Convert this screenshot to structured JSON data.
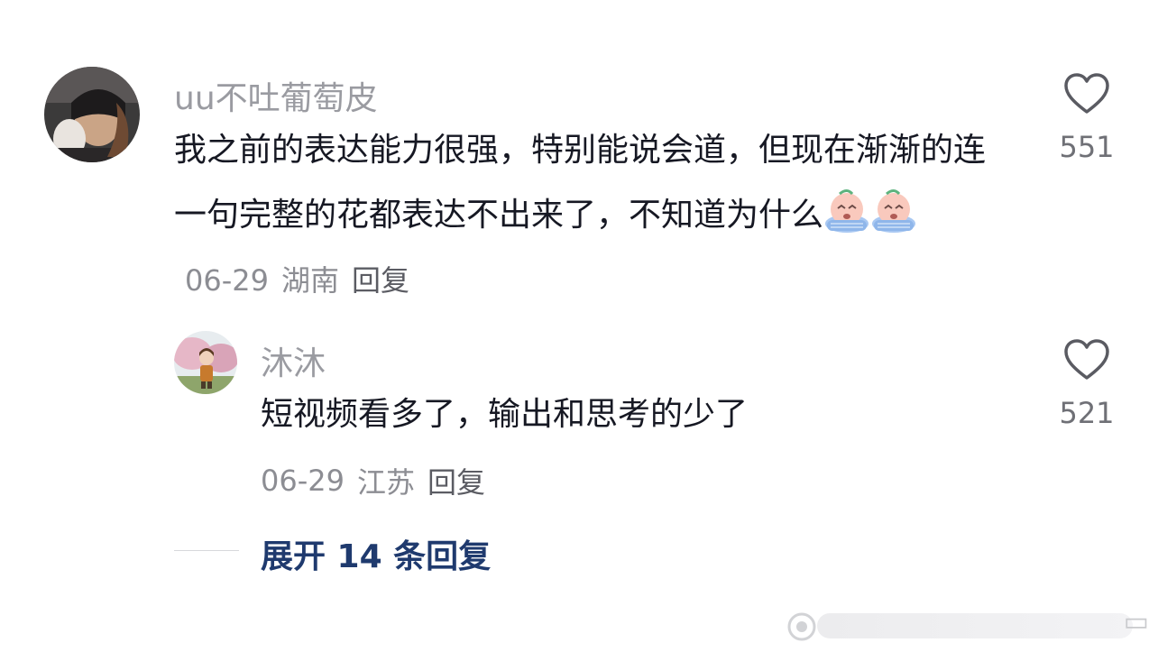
{
  "comments": [
    {
      "username": "uu不吐葡萄皮",
      "text_main": "我之前的表达能力很强，特别能说会道，但现在渐渐的连一句完整的花都表达不出来了，不知道为什么",
      "emojis": [
        "crying-face-emoji",
        "crying-face-emoji"
      ],
      "date": "06-29",
      "location": "湖南",
      "reply_label": "回复",
      "likes": "551"
    },
    {
      "username": "沐沐",
      "text_main": "短视频看多了，输出和思考的少了",
      "date": "06-29",
      "location": "江苏",
      "reply_label": "回复",
      "likes": "521"
    }
  ],
  "expand": {
    "label": "展开 14 条回复"
  },
  "icons": {
    "like": "heart-outline-icon"
  },
  "colors": {
    "username": "#9a9ba1",
    "text": "#161823",
    "meta": "#8c8d93",
    "expand": "#1f3a6e"
  }
}
